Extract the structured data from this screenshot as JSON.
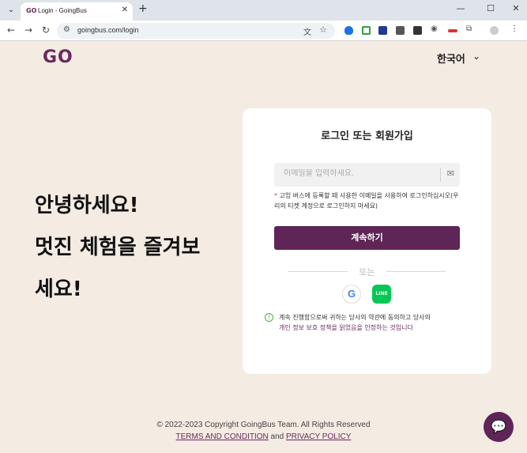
{
  "browser": {
    "tab_title": "Login - GoingBus",
    "tab_favicon": "GO",
    "url": "goingbus.com/login"
  },
  "page": {
    "logo": "GO",
    "language": "한국어",
    "hero_line1": "안녕하세요!",
    "hero_line2": "멋진 체험을 즐겨보",
    "hero_line3": "세요!"
  },
  "card": {
    "title": "로그인 또는 회원가입",
    "email_placeholder": "이메일을 입력하세요.",
    "notice_asterisk": "*",
    "notice_text": "고잉 버스에 등록할 때 사용한 이메일을 사용하여 로그인하십시오(우리의 티켓 계정으로 로그인하지 마세요)",
    "continue_label": "계속하기",
    "or_label": "또는",
    "google_label": "G",
    "line_label": "LINE",
    "terms_prefix": "계속 진행함으로써 귀하는 당사의 약관에 동의하고 당사의",
    "terms_link": "개인 정보 보호 정책을 읽었음을 인정하는 것입니다"
  },
  "footer": {
    "copyright": "© 2022-2023 Copyright GoingBus Team. All Rights Reserved",
    "terms_link": "TERMS AND CONDITION",
    "and": "and",
    "privacy_link": "PRIVACY POLICY"
  },
  "colors": {
    "brand": "#6a2a5e",
    "button": "#5e2556",
    "background": "#f4ebe3"
  }
}
